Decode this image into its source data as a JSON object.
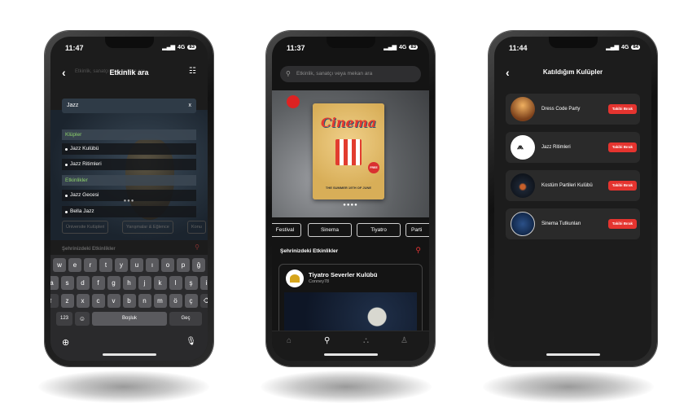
{
  "phone1": {
    "status": {
      "time": "11:47",
      "network": "4G",
      "battery": "83"
    },
    "header": {
      "title": "Etkinlik ara",
      "placeholder": "Etkinlik, sanatçı veya mekan ara"
    },
    "search_value": "Jazz",
    "clear_label": "x",
    "sections": [
      {
        "title": "Klüpler",
        "items": [
          "Jazz Kulübü",
          "Jazz Ritimleri"
        ]
      },
      {
        "title": "Etkinlikler",
        "items": [
          "Jazz Gecesi",
          "Bella Jazz"
        ]
      }
    ],
    "chips": [
      "Üniversite Kulüpleri",
      "Yarışmalar & Eğlence",
      "Konu"
    ],
    "section_label": "Şehrinizdeki Etkinlikler",
    "keyboard": {
      "row1": [
        "q",
        "w",
        "e",
        "r",
        "t",
        "y",
        "u",
        "ı",
        "o",
        "p",
        "ğ",
        "ü"
      ],
      "row2": [
        "a",
        "s",
        "d",
        "f",
        "g",
        "h",
        "j",
        "k",
        "l",
        "ş",
        "i"
      ],
      "row3": [
        "z",
        "x",
        "c",
        "v",
        "b",
        "n",
        "m",
        "ö",
        "ç"
      ],
      "num_label": "123",
      "space_label": "Boşluk",
      "go_label": "Geç"
    }
  },
  "phone2": {
    "status": {
      "time": "11:37",
      "network": "4G",
      "battery": "83"
    },
    "search_placeholder": "Etkinlik, sanatçı veya mekan ara",
    "poster": {
      "title": "Cinema",
      "sub": "THE SUMMER 19TH OF JUNE",
      "free": "FREE"
    },
    "categories": [
      "Festival",
      "Sinema",
      "Tiyatro",
      "Parti"
    ],
    "section_label": "Şehrinizdeki Etkinlikler",
    "card": {
      "name": "Tiyatro Severler Kulübü",
      "user": "Conney78"
    }
  },
  "phone3": {
    "status": {
      "time": "11:44",
      "network": "4G",
      "battery": "84"
    },
    "title": "Katıldığım Kulüpler",
    "button_label": "Takibi Bırak",
    "clubs": [
      {
        "name": "Dress Code Party",
        "color": "#c8782e"
      },
      {
        "name": "Jazz Ritimleri",
        "color": "#ffffff"
      },
      {
        "name": "Kostüm Partileri Kulübü",
        "color": "#1c2533"
      },
      {
        "name": "Sinema Tutkunları",
        "color": "#1d3a63"
      }
    ]
  }
}
